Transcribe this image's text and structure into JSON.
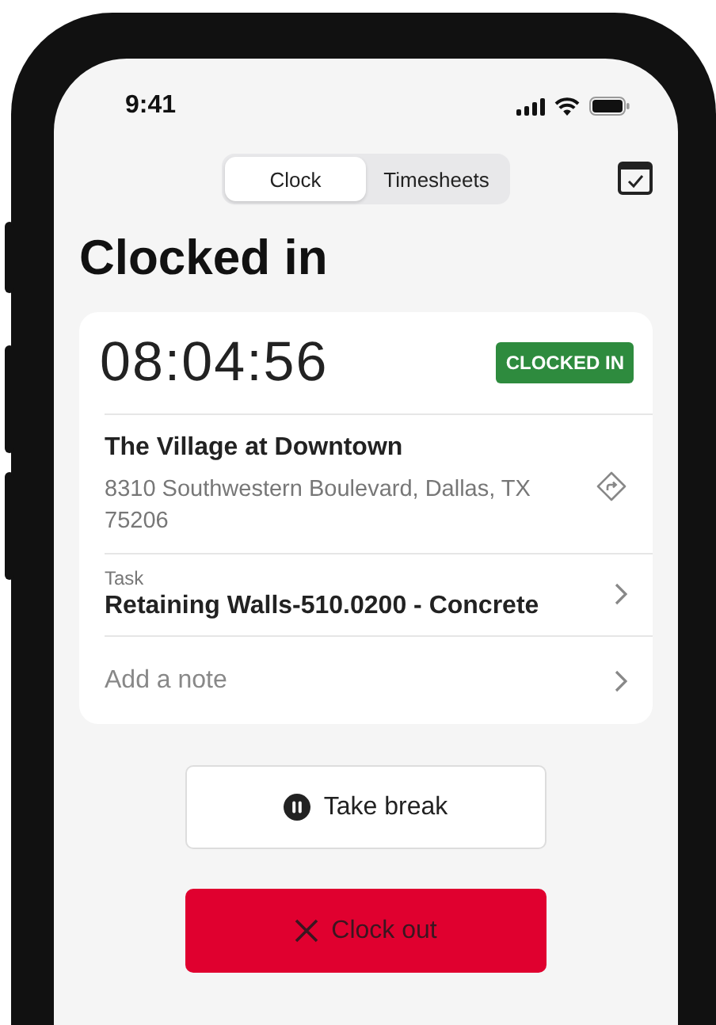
{
  "status_bar": {
    "time": "9:41"
  },
  "tabs": [
    {
      "label": "Clock",
      "selected": true
    },
    {
      "label": "Timesheets",
      "selected": false
    }
  ],
  "title": "Clocked in",
  "timer": "08:04:56",
  "status_badge": "CLOCKED IN",
  "location": {
    "name": "The Village at Downtown",
    "address": "8310 Southwestern Boulevard, Dallas, TX 75206"
  },
  "task": {
    "label": "Task",
    "value": "Retaining Walls-510.0200 - Concrete"
  },
  "note": {
    "placeholder": "Add a note"
  },
  "buttons": [
    {
      "kind": "break",
      "label": "Take break"
    },
    {
      "kind": "clockout",
      "label": "Clock out"
    }
  ]
}
